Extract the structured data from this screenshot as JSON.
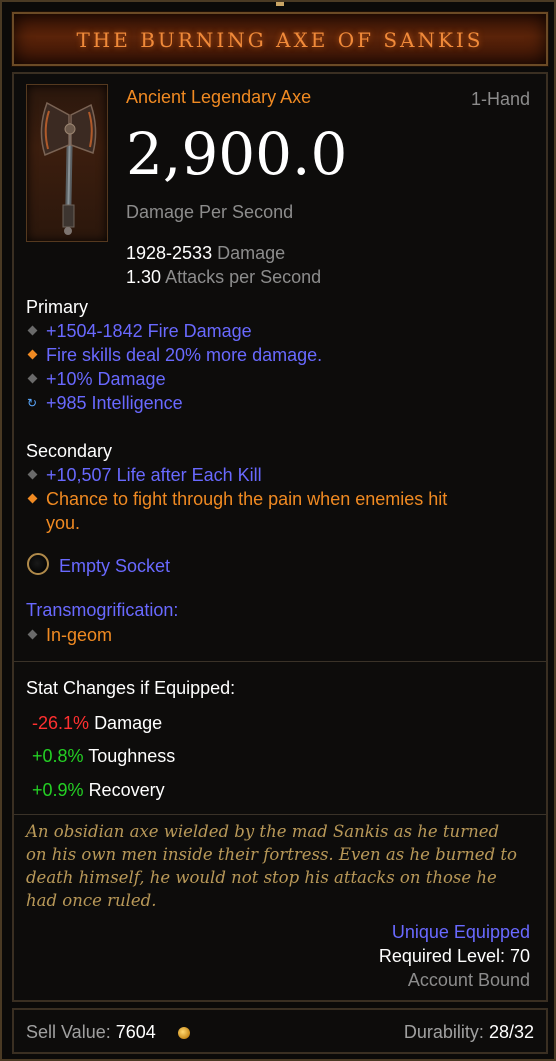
{
  "header": {
    "title": "THE BURNING AXE OF SANKIS"
  },
  "item": {
    "type": "Ancient Legendary Axe",
    "slot": "1-Hand",
    "dps": "2,900.0",
    "dps_label": "Damage Per Second",
    "damage_value": "1928-2533",
    "damage_label": "Damage",
    "aps_value": "1.30",
    "aps_label": "Attacks per Second",
    "icon": "axe-icon"
  },
  "primary": {
    "title": "Primary",
    "affixes": [
      {
        "text": "+1504-1842 Fire Damage",
        "bullet": "gray-diamond-icon"
      },
      {
        "text": "Fire skills deal 20% more damage.",
        "bullet": "orange-diamond-icon"
      },
      {
        "text": "+10% Damage",
        "bullet": "gray-diamond-icon"
      },
      {
        "text": "+985 Intelligence",
        "bullet": "reroll-icon"
      }
    ]
  },
  "secondary": {
    "title": "Secondary",
    "affixes": [
      {
        "text": "+10,507 Life after Each Kill",
        "bullet": "gray-diamond-icon"
      },
      {
        "text_line1": "Chance to fight through the pain when enemies hit",
        "text_line2": "you.",
        "bullet": "orange-diamond-icon"
      }
    ]
  },
  "socket": {
    "label": "Empty Socket"
  },
  "transmog": {
    "title": "Transmogrification:",
    "value": "In-geom"
  },
  "stats": {
    "title": "Stat Changes if Equipped:",
    "rows": [
      {
        "delta": "-26.1%",
        "label": "Damage",
        "sign": "negative"
      },
      {
        "delta": "+0.8%",
        "label": "Toughness",
        "sign": "positive"
      },
      {
        "delta": "+0.9%",
        "label": "Recovery",
        "sign": "positive"
      }
    ]
  },
  "flavor": {
    "lines": [
      "An obsidian axe wielded by the mad Sankis as he turned",
      "on his own men inside their fortress. Even as he burned to",
      "death himself, he would not stop his attacks on those he",
      "had once ruled."
    ]
  },
  "meta": {
    "unique_equipped": "Unique Equipped",
    "required_level": "Required Level: 70",
    "account_bound": "Account Bound"
  },
  "footer": {
    "sell_label": "Sell Value:",
    "sell_value": "7604",
    "durability_label": "Durability:",
    "durability_value": "28/32"
  },
  "colors": {
    "title": "#f08a3a",
    "magic_blue": "#6969ff",
    "legendary_orange": "#f08a22",
    "negative": "#ff3030",
    "positive": "#24d024",
    "flavor": "#b89858"
  }
}
